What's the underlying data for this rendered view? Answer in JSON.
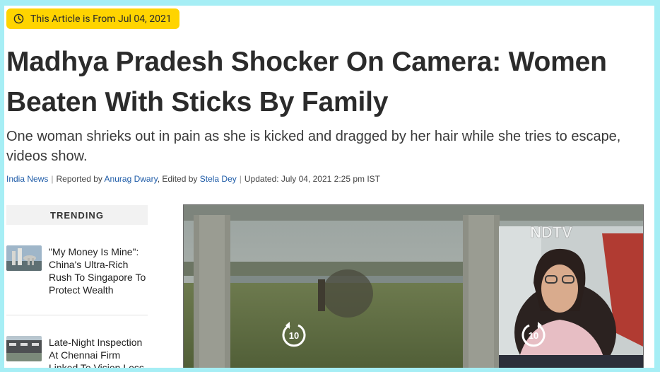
{
  "badge": {
    "text": "This Article is From Jul 04, 2021",
    "icon": "clock-icon",
    "color": "#ffd400"
  },
  "article": {
    "headline": "Madhya Pradesh Shocker On Camera: Women Beaten With Sticks By Family",
    "summary": "One woman shrieks out in pain as she is kicked and dragged by her hair while she tries to escape, videos show.",
    "byline": {
      "section": "India News",
      "reported_prefix": "Reported by",
      "reporter": "Anurag Dwary",
      "edited_prefix": ", Edited by",
      "editor": "Stela Dey",
      "updated": "Updated: July 04, 2021 2:25 pm IST"
    }
  },
  "trending": {
    "title": "TRENDING",
    "items": [
      {
        "title": "\"My Money Is Mine\": China's Ultra-Rich Rush To Singapore To Protect Wealth"
      },
      {
        "title": "Late-Night Inspection At Chennai Firm Linked To Vision Loss"
      }
    ]
  },
  "video": {
    "watermark": "NDTV",
    "rewind_label": "10",
    "forward_label": "10"
  },
  "colors": {
    "background": "#a6eef5",
    "link": "#1f5ca8",
    "badge": "#ffd400"
  }
}
